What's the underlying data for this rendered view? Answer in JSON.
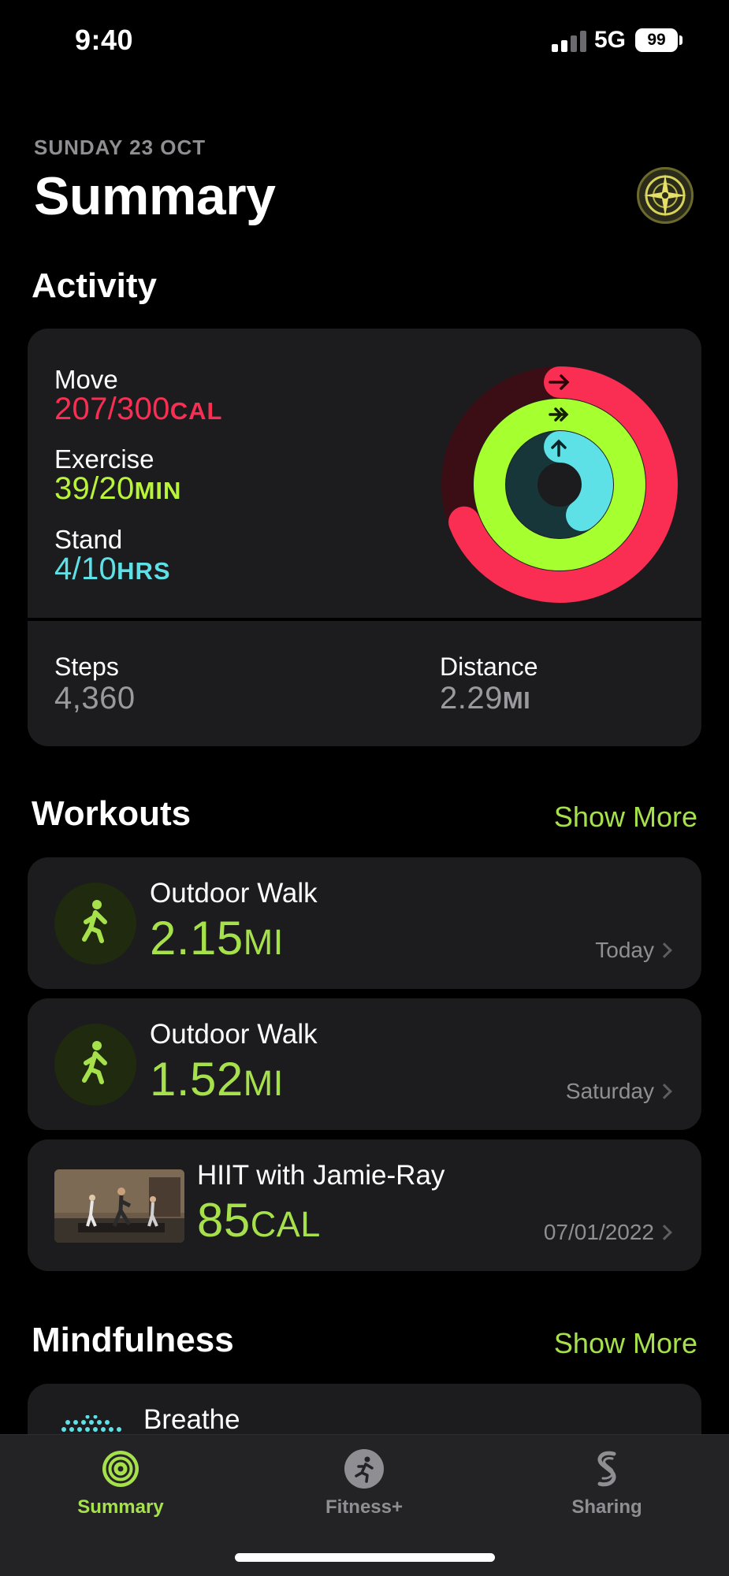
{
  "status_bar": {
    "time": "9:40",
    "network": "5G",
    "battery": "99"
  },
  "header": {
    "date": "SUNDAY 23 OCT",
    "title": "Summary"
  },
  "activity": {
    "title": "Activity",
    "move": {
      "label": "Move",
      "value": "207/300",
      "unit": "CAL",
      "color": "#fa2e53",
      "progress": 0.69
    },
    "exercise": {
      "label": "Exercise",
      "value": "39/20",
      "unit": "MIN",
      "color": "#a6ff2f",
      "progress": 1.95
    },
    "stand": {
      "label": "Stand",
      "value": "4/10",
      "unit": "HRS",
      "color": "#5de1e6",
      "progress": 0.4
    },
    "steps": {
      "label": "Steps",
      "value": "4,360"
    },
    "distance": {
      "label": "Distance",
      "value": "2.29",
      "unit": "MI"
    }
  },
  "workouts": {
    "title": "Workouts",
    "show_more": "Show More",
    "items": [
      {
        "name": "Outdoor Walk",
        "value": "2.15",
        "unit": "MI",
        "date": "Today",
        "icon": "walk-icon"
      },
      {
        "name": "Outdoor Walk",
        "value": "1.52",
        "unit": "MI",
        "date": "Saturday",
        "icon": "walk-icon"
      },
      {
        "name": "HIIT with Jamie-Ray",
        "value": "85",
        "unit": "CAL",
        "date": "07/01/2022",
        "icon": "video-thumbnail"
      }
    ]
  },
  "mindfulness": {
    "title": "Mindfulness",
    "show_more": "Show More",
    "items": [
      {
        "name": "Breathe",
        "icon": "breathe-icon"
      }
    ]
  },
  "tab_bar": {
    "tabs": [
      {
        "label": "Summary",
        "icon": "activity-rings-icon",
        "active": true
      },
      {
        "label": "Fitness+",
        "icon": "runner-icon",
        "active": false
      },
      {
        "label": "Sharing",
        "icon": "sharing-icon",
        "active": false
      }
    ]
  },
  "colors": {
    "accent": "#a6e14c",
    "background": "#000000",
    "card": "#1c1c1e",
    "secondary_text": "#8e8e93"
  }
}
